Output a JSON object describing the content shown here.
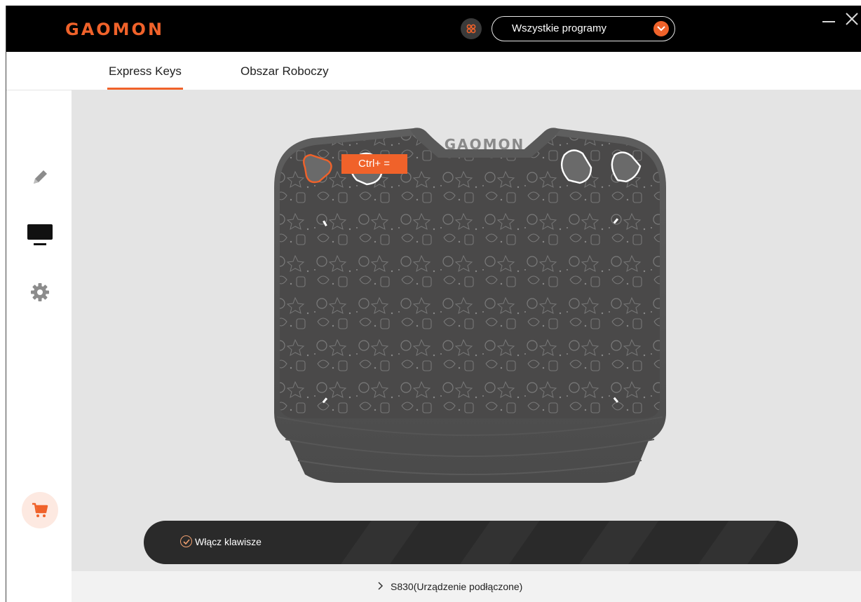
{
  "brand": {
    "logo_text": "GAOMON",
    "accent_color": "#f0622a"
  },
  "header": {
    "app_icon": "apps-grid-icon",
    "program_select": {
      "value": "Wszystkie programy"
    },
    "window_controls": [
      "minimize-icon",
      "close-icon"
    ]
  },
  "tabs": [
    {
      "label": "Express Keys",
      "active": true
    },
    {
      "label": "Obszar Roboczy",
      "active": false
    }
  ],
  "sidebar": {
    "items": [
      {
        "icon": "pen-icon",
        "active": false
      },
      {
        "icon": "monitor-icon",
        "active": true
      },
      {
        "icon": "gear-icon",
        "active": false
      }
    ],
    "shop": {
      "icon": "cart-icon"
    }
  },
  "tablet": {
    "logo_text": "GAOMON",
    "selected_key_label": "Ctrl+ ="
  },
  "status": {
    "enable_label": "Włącz klawisze",
    "enabled": true
  },
  "footer": {
    "device_label": "S830(Urządzenie podłączone)"
  }
}
